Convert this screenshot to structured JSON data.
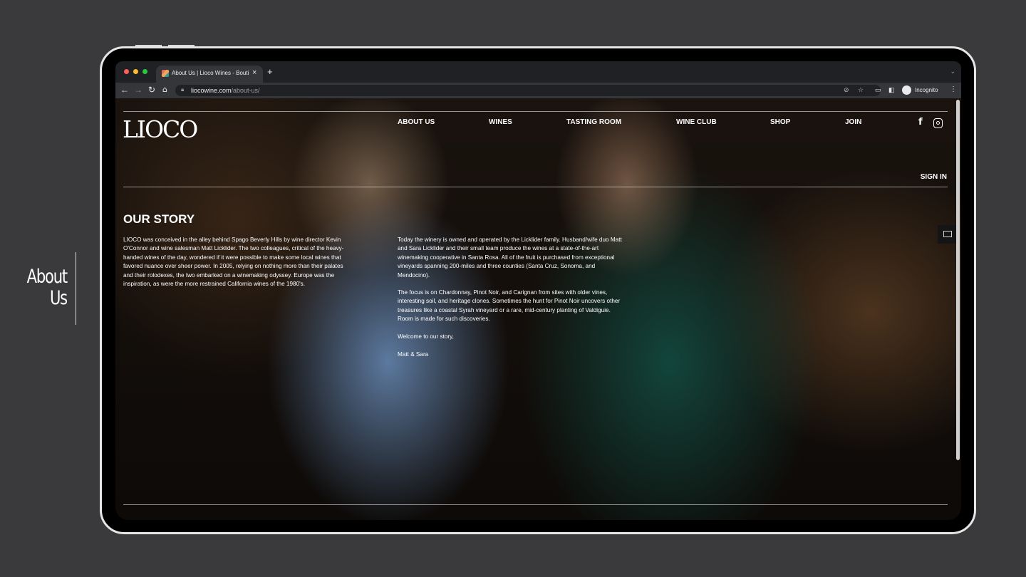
{
  "slide": {
    "label_line1": "About",
    "label_line2": "Us"
  },
  "browser": {
    "tab_title": "About Us | Lioco Wines - Bouti",
    "tab_close": "×",
    "new_tab": "+",
    "tab_menu": "⌄",
    "url_host": "liocowine.com",
    "url_path": "/about-us/",
    "profile_label": "Incognito",
    "icons": [
      "back-icon",
      "forward-icon",
      "reload-icon",
      "home-icon",
      "lock-icon",
      "eye-off-icon",
      "star-icon",
      "cast-icon",
      "side-panel-icon",
      "incognito-icon",
      "more-icon"
    ]
  },
  "site": {
    "logo": "LIOCO",
    "nav": [
      "ABOUT US",
      "WINES",
      "TASTING ROOM",
      "WINE CLUB",
      "SHOP",
      "JOIN"
    ],
    "social_icons": [
      "facebook-icon",
      "instagram-icon"
    ],
    "facebook_glyph": "f",
    "sign_in": "SIGN IN",
    "heading": "OUR STORY",
    "col1_p1": "LIOCO was conceived in the alley behind Spago Beverly Hills by wine director Kevin O'Connor and wine salesman Matt Licklider. The two colleagues, critical of the heavy-handed wines of the day, wondered if it were possible to make some local wines that favored nuance over sheer power. In 2005, relying on nothing more than their palates and their rolodexes, the two embarked on a winemaking odyssey. Europe was the inspiration, as were the more restrained California wines of the 1980's.",
    "col2_p1": "Today the winery is owned and operated by the Licklider family. Husband/wife duo Matt and Sara Licklider and their small team produce the wines at a state-of-the-art winemaking cooperative in Santa Rosa. All of the fruit is purchased from exceptional vineyards spanning 200-miles and three counties (Santa Cruz, Sonoma, and Mendocino).",
    "col2_p2": "The focus is on Chardonnay, Pinot Noir, and Carignan from sites with older vines, interesting soil, and heritage clones. Sometimes the hunt for Pinot Noir uncovers other treasures like a coastal Syrah vineyard or a rare, mid-century planting of Valdiguie. Room is made for such discoveries.",
    "col2_p3": "Welcome to our story,",
    "col2_p4": "Matt & Sara",
    "mail_icon": "mail-icon"
  },
  "colors": {
    "slide_background": "#3a3a3c",
    "browser_tabbar": "#202124",
    "browser_toolbar": "#35363a",
    "text": "#ffffff"
  }
}
